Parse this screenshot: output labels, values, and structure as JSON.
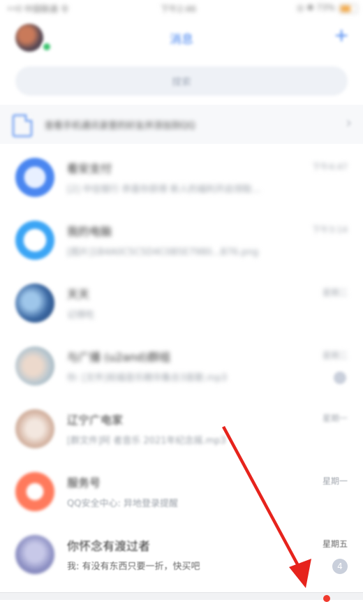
{
  "status_bar": {
    "carrier": "••ll 中国联通 令",
    "time": "下午2:46",
    "right": "◎ ✱ 73%"
  },
  "header": {
    "title": "消息",
    "add_symbol": "+"
  },
  "search": {
    "placeholder": "搜索"
  },
  "banner": {
    "text": "查看手机通讯录里的好友并添加到QQ"
  },
  "conversations": [
    {
      "name": "看安支付",
      "message": "[2] 中信银行 恭喜你获得 新人的福利开启领取...",
      "time": "下午4:47"
    },
    {
      "name": "我的电脑",
      "message": "[图片]1B4A0C5C5D4C0B5E7980...B76.png",
      "time": "下午3:14"
    },
    {
      "name": "天天",
      "message": "记得吃",
      "time": "星期二"
    },
    {
      "name": "与广播 (u2and)群组",
      "message": "你: [文件]祝福音乐精华集合3首歌.mp3",
      "time": "星期二"
    },
    {
      "name": "辽宁广电家",
      "message": "[群文件]阿 者音乐 2021年纪念摇.mp3",
      "time": "星期一"
    },
    {
      "name": "服务号",
      "message": "QQ安全中心: 异地登录提醒",
      "time": "星期一"
    },
    {
      "name": "你怀念有渡过者",
      "message": "我: 有没有东西只要一折，快买吧",
      "time": "星期五",
      "badge": "4"
    }
  ]
}
